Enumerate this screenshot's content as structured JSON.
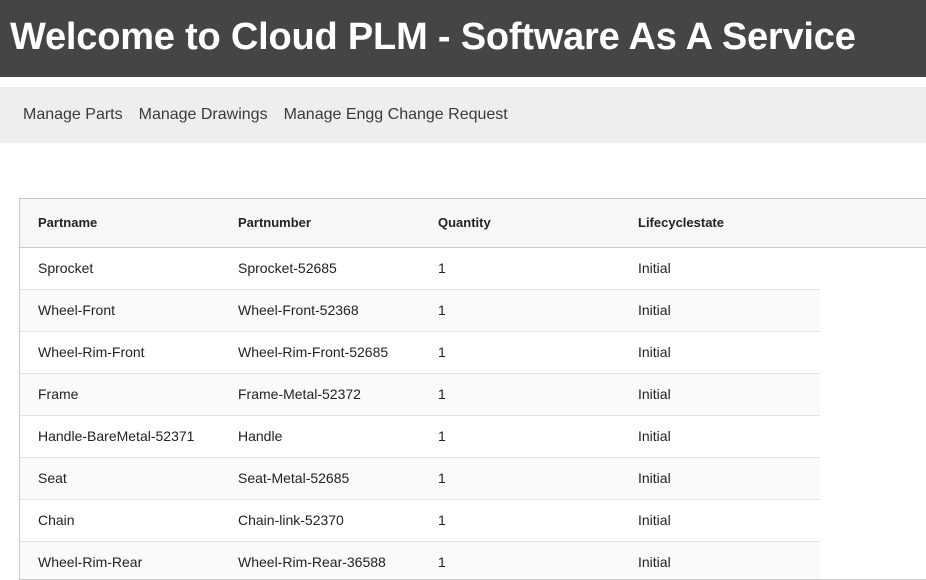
{
  "header": {
    "title": "Welcome to Cloud PLM - Software As A Service"
  },
  "nav": {
    "items": [
      {
        "label": "Manage Parts"
      },
      {
        "label": "Manage Drawings"
      },
      {
        "label": "Manage Engg Change Request"
      }
    ]
  },
  "parts_table": {
    "columns": [
      "Partname",
      "Partnumber",
      "Quantity",
      "Lifecyclestate"
    ],
    "rows": [
      [
        "Sprocket",
        "Sprocket-52685",
        "1",
        "Initial"
      ],
      [
        "Wheel-Front",
        "Wheel-Front-52368",
        "1",
        "Initial"
      ],
      [
        "Wheel-Rim-Front",
        "Wheel-Rim-Front-52685",
        "1",
        "Initial"
      ],
      [
        "Frame",
        "Frame-Metal-52372",
        "1",
        "Initial"
      ],
      [
        "Handle-BareMetal-52371",
        "Handle",
        "1",
        "Initial"
      ],
      [
        "Seat",
        "Seat-Metal-52685",
        "1",
        "Initial"
      ],
      [
        "Chain",
        "Chain-link-52370",
        "1",
        "Initial"
      ],
      [
        "Wheel-Rim-Rear",
        "Wheel-Rim-Rear-36588",
        "1",
        "Initial"
      ]
    ]
  }
}
